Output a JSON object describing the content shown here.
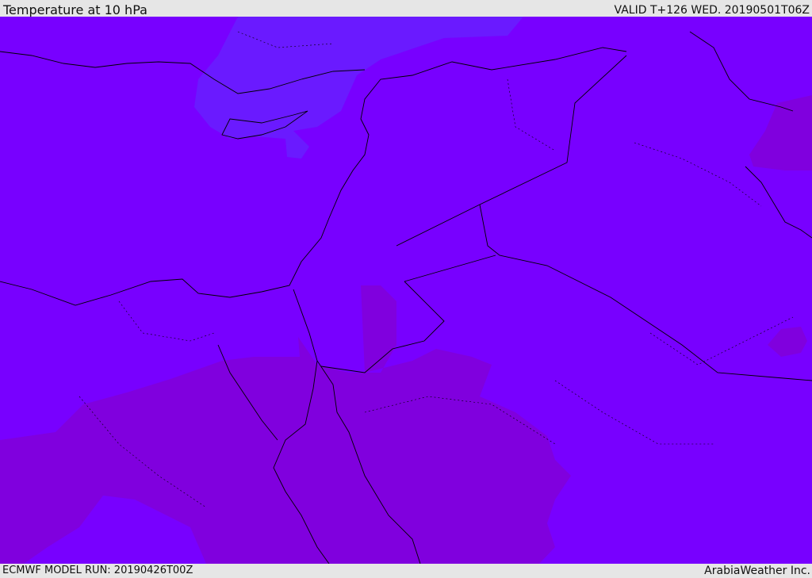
{
  "header": {
    "title": "Temperature at 10 hPa",
    "valid": "VALID T+126 WED. 20190501T06Z"
  },
  "footer": {
    "model_run": "ECMWF MODEL RUN: 20190426T00Z",
    "credit": "ArabiaWeather Inc."
  },
  "map": {
    "variable": "Temperature",
    "level": "10 hPa",
    "colors": {
      "base_field": "#7800ff",
      "cold_field": "#6a1aff",
      "warm_field": "#8000de",
      "coastline": "#000000",
      "borders": "#000000"
    }
  }
}
